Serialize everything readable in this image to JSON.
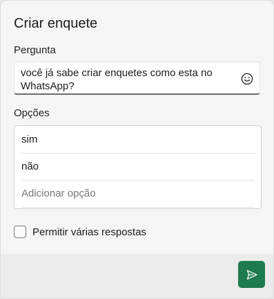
{
  "dialog": {
    "title": "Criar enquete"
  },
  "question": {
    "label": "Pergunta",
    "value": "você já sabe criar enquetes como esta no WhatsApp?",
    "emoji_icon": "smiley-icon"
  },
  "options": {
    "label": "Opções",
    "items": [
      "sim",
      "não"
    ],
    "add_placeholder": "Adicionar opção"
  },
  "multiple": {
    "label": "Permitir várias respostas",
    "checked": false
  },
  "send": {
    "icon": "send-icon",
    "color": "#1e7a4f"
  }
}
